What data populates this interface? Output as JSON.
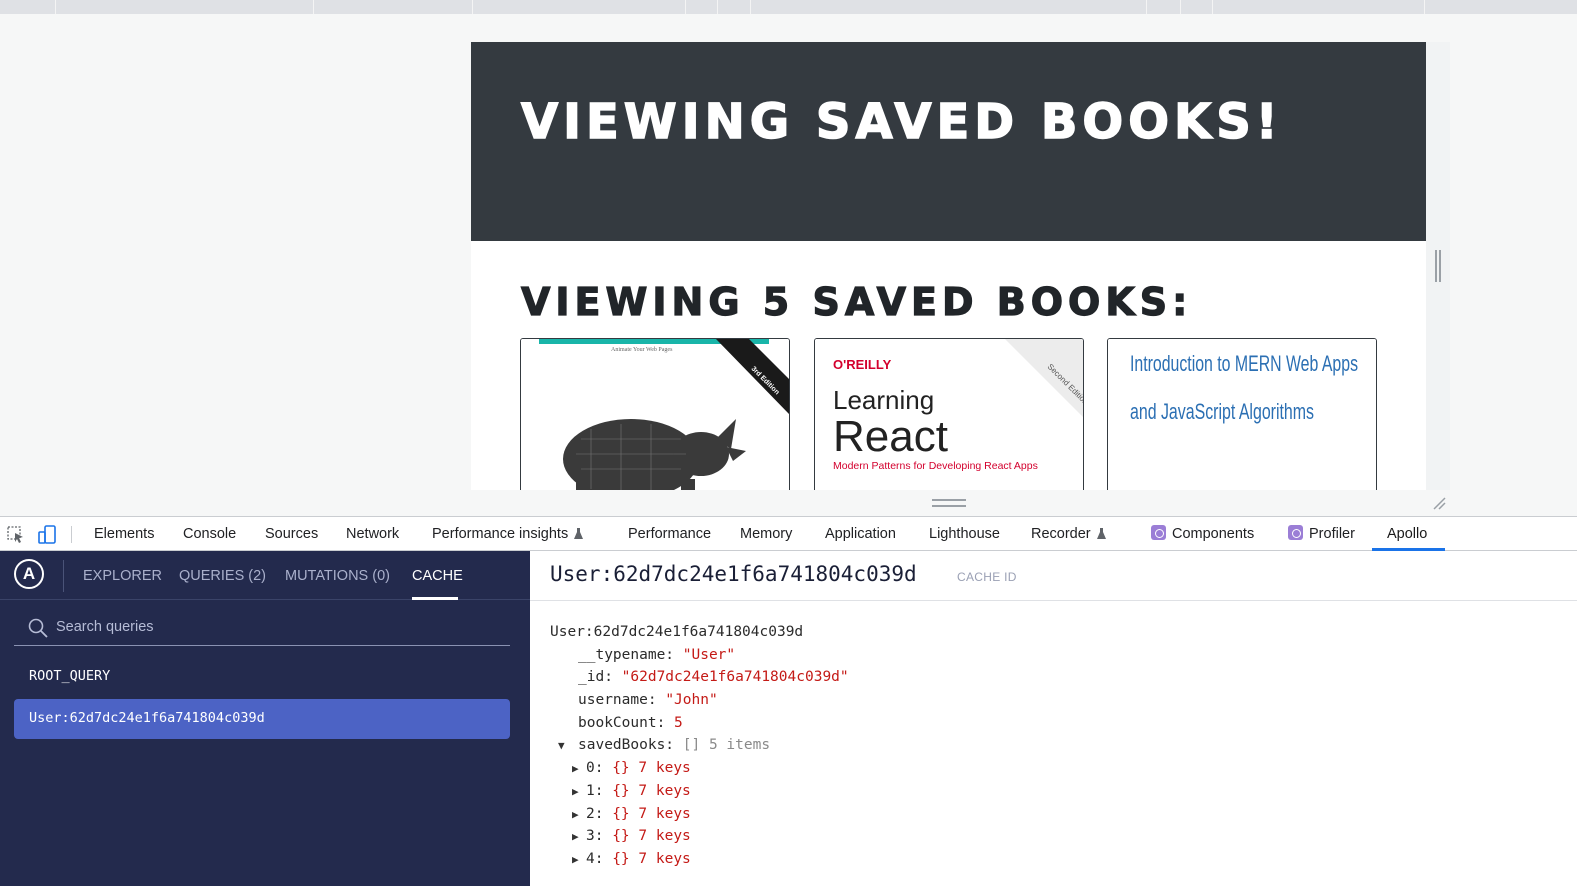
{
  "page": {
    "hero_title": "VIEWING SAVED BOOKS!",
    "subheading": "VIEWING 5 SAVED BOOKS:",
    "book_covers": [
      {
        "publisher_tag": "",
        "cover_text": "Rhino cover"
      },
      {
        "publisher": "O'REILLY",
        "title_line1": "Learning",
        "title_line2": "React",
        "subtitle": "Modern Patterns for Developing React Apps",
        "edition": "Second Edition"
      },
      {
        "title_line1": "Introduction to MERN Web Apps",
        "title_line2": "and JavaScript Algorithms"
      }
    ]
  },
  "devtools": {
    "tabs": [
      "Elements",
      "Console",
      "Sources",
      "Network",
      "Performance insights",
      "Performance",
      "Memory",
      "Application",
      "Lighthouse",
      "Recorder",
      "Components",
      "Profiler",
      "Apollo"
    ],
    "active_tab": "Apollo"
  },
  "apollo": {
    "nav": [
      "EXPLORER",
      "QUERIES (2)",
      "MUTATIONS (0)",
      "CACHE"
    ],
    "active_nav": "CACHE",
    "search_placeholder": "Search queries",
    "root_query": "ROOT_QUERY",
    "selected_entry": "User:62d7dc24e1f6a741804c039d",
    "detail": {
      "title": "User:62d7dc24e1f6a741804c039d",
      "title_badge": "CACHE ID",
      "root_label": "User:62d7dc24e1f6a741804c039d",
      "fields": [
        {
          "key": "__typename:",
          "value": "\"User\""
        },
        {
          "key": "_id:",
          "value": "\"62d7dc24e1f6a741804c039d\""
        },
        {
          "key": "username:",
          "value": "\"John\""
        },
        {
          "key": "bookCount:",
          "value": "5"
        }
      ],
      "saved_books": {
        "key": "savedBooks:",
        "bracket": "[]",
        "count": "5 items",
        "items": [
          {
            "key": "0:",
            "brace": "{}",
            "count": "7 keys"
          },
          {
            "key": "1:",
            "brace": "{}",
            "count": "7 keys"
          },
          {
            "key": "2:",
            "brace": "{}",
            "count": "7 keys"
          },
          {
            "key": "3:",
            "brace": "{}",
            "count": "7 keys"
          },
          {
            "key": "4:",
            "brace": "{}",
            "count": "7 keys"
          }
        ]
      }
    }
  },
  "colors": {
    "hero_bg": "#343a40",
    "apollo_sidebar": "#232a4d",
    "apollo_selected": "#4c63c5",
    "devtools_accent": "#1a73e8",
    "value_red": "#c41a16"
  }
}
